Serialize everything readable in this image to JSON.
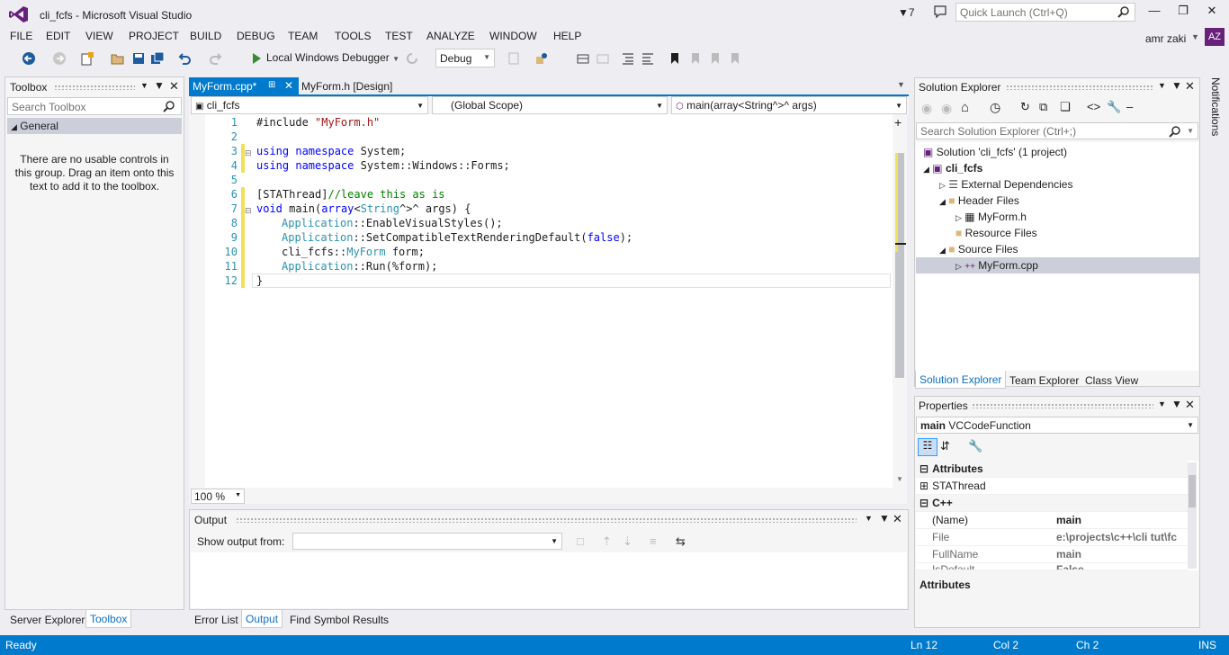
{
  "window": {
    "title": "cli_fcfs - Microsoft Visual Studio",
    "notification_count": "7",
    "quick_launch_placeholder": "Quick Launch (Ctrl+Q)"
  },
  "menu": [
    "FILE",
    "EDIT",
    "VIEW",
    "PROJECT",
    "BUILD",
    "DEBUG",
    "TEAM",
    "TOOLS",
    "TEST",
    "ANALYZE",
    "WINDOW",
    "HELP"
  ],
  "user": {
    "name": "amr zaki",
    "initials": "AZ"
  },
  "toolbar": {
    "debugger": "Local Windows Debugger",
    "configuration": "Debug"
  },
  "toolbox": {
    "title": "Toolbox",
    "search_placeholder": "Search Toolbox",
    "group": "General",
    "empty_message": "There are no usable controls in this group. Drag an item onto this text to add it to the toolbox.",
    "bottom_tabs": [
      "Server Explorer",
      "Toolbox"
    ]
  },
  "editor": {
    "tabs": [
      {
        "label": "MyForm.cpp*"
      },
      {
        "label": "MyForm.h [Design]"
      }
    ],
    "nav": {
      "project": "cli_fcfs",
      "scope": "(Global Scope)",
      "member": "main(array<String^>^ args)"
    },
    "line_numbers": [
      "1",
      "2",
      "3",
      "4",
      "5",
      "6",
      "7",
      "8",
      "9",
      "10",
      "11",
      "12"
    ],
    "zoom": "100 %"
  },
  "output": {
    "title": "Output",
    "show_from_label": "Show output from:",
    "bottom_tabs": [
      "Error List",
      "Output",
      "Find Symbol Results"
    ]
  },
  "solution_explorer": {
    "title": "Solution Explorer",
    "search_placeholder": "Search Solution Explorer (Ctrl+;)",
    "tree": [
      {
        "label": "Solution 'cli_fcfs' (1 project)"
      },
      {
        "label": "cli_fcfs"
      },
      {
        "label": "External Dependencies"
      },
      {
        "label": "Header Files"
      },
      {
        "label": "MyForm.h"
      },
      {
        "label": "Resource Files"
      },
      {
        "label": "Source Files"
      },
      {
        "label": "MyForm.cpp"
      }
    ],
    "bottom_tabs": [
      "Solution Explorer",
      "Team Explorer",
      "Class View"
    ]
  },
  "properties": {
    "title": "Properties",
    "object_name": "main",
    "object_type": "VCCodeFunction",
    "rows": [
      {
        "name": "Attributes",
        "value": "",
        "category": true
      },
      {
        "name": "STAThread",
        "value": "",
        "category": false
      },
      {
        "name": "C++",
        "value": "",
        "category": true
      },
      {
        "name": "(Name)",
        "value": "main",
        "category": false
      },
      {
        "name": "File",
        "value": "e:\\projects\\c++\\cli tut\\fc",
        "category": false
      },
      {
        "name": "FullName",
        "value": "main",
        "category": false
      },
      {
        "name": "IsDefault",
        "value": "False",
        "category": false
      }
    ],
    "description_title": "Attributes"
  },
  "notifications_label": "Notifications",
  "status": {
    "text": "Ready",
    "line": "Ln 12",
    "col": "Col 2",
    "ch": "Ch 2",
    "mode": "INS"
  }
}
